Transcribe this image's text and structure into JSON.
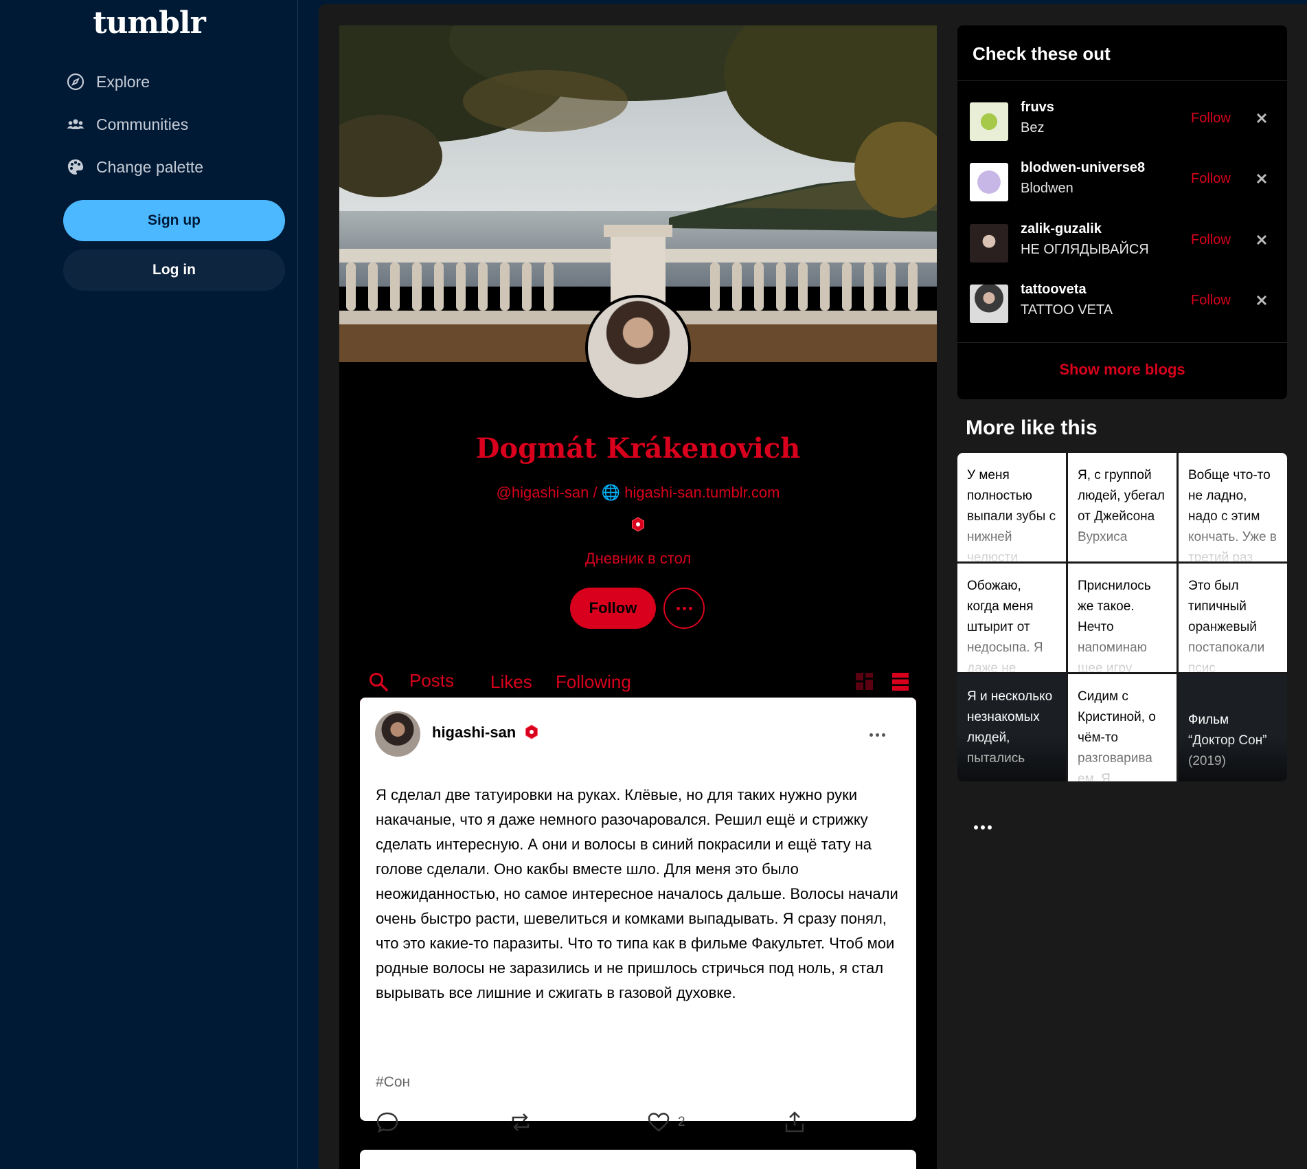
{
  "app": {
    "logo": "tumblr"
  },
  "sidebar": {
    "items": [
      {
        "label": "Explore",
        "icon": "compass-icon"
      },
      {
        "label": "Communities",
        "icon": "people-icon"
      },
      {
        "label": "Change palette",
        "icon": "palette-icon"
      }
    ],
    "signup_label": "Sign up",
    "login_label": "Log in"
  },
  "blog": {
    "title": "Dogmát Krákenovich",
    "handle": "@higashi-san",
    "separator": " / ",
    "url": "higashi-san.tumblr.com",
    "description": "Дневник в стол",
    "follow_label": "Follow",
    "tabs": [
      "Posts",
      "Likes",
      "Following"
    ]
  },
  "post": {
    "author": "higashi-san",
    "body": "Я сделал две татуировки на руках. Клёвые, но для таких нужно руки накачаные, что я даже немного разочаровался. Решил ещё и стрижку сделать интересную. А они и волосы в синий покрасили и ещё тату на голове сделали. Оно какбы вместе шло. Для меня это было неожиданностью, но самое интересное началось дальше. Волосы начали очень быстро расти, шевелиться и комками выпадывать. Я сразу понял, что это какие-то паразиты. Что то типа как в фильме Факультет. Чтоб мои родные волосы не заразились и не пришлось стричься под ноль, я стал вырывать все лишние и сжигать в газовой духовке.",
    "tag": "#Сон",
    "likes": "2"
  },
  "check_these_out": {
    "title": "Check these out",
    "follow_label": "Follow",
    "blogs": [
      {
        "name": "fruvs",
        "subtitle": "Bez"
      },
      {
        "name": "blodwen-universe8",
        "subtitle": "Blodwen"
      },
      {
        "name": "zalik-guzalik",
        "subtitle": "НЕ ОГЛЯДЫВАЙСЯ"
      },
      {
        "name": "tattooveta",
        "subtitle": "TATTOO VETA"
      }
    ],
    "show_more": "Show more blogs"
  },
  "more_like_this": {
    "title": "More like this",
    "tiles": [
      "У меня полностью выпали зубы с нижней челюсти",
      "Я, с группой людей, убегал от Джейсона Вурхиса",
      "Вобще что-то не ладно, надо с этим кончать. Уже в третий раз",
      "Обожаю, когда меня штырит от недосыпа. Я даже не",
      "Приснилось же такое. Нечто напоминаю щее игру",
      "Это был типичный оранжевый постапокали псис",
      "Я и несколько незнакомых людей, пытались",
      "Сидим с Кристиной, о чём-то разговарива ем. Я",
      "Фильм “Доктор Сон” (2019)"
    ]
  },
  "colors": {
    "accent": "#d8001c",
    "sidebar_bg": "#001935",
    "signup": "#4cb8ff"
  }
}
